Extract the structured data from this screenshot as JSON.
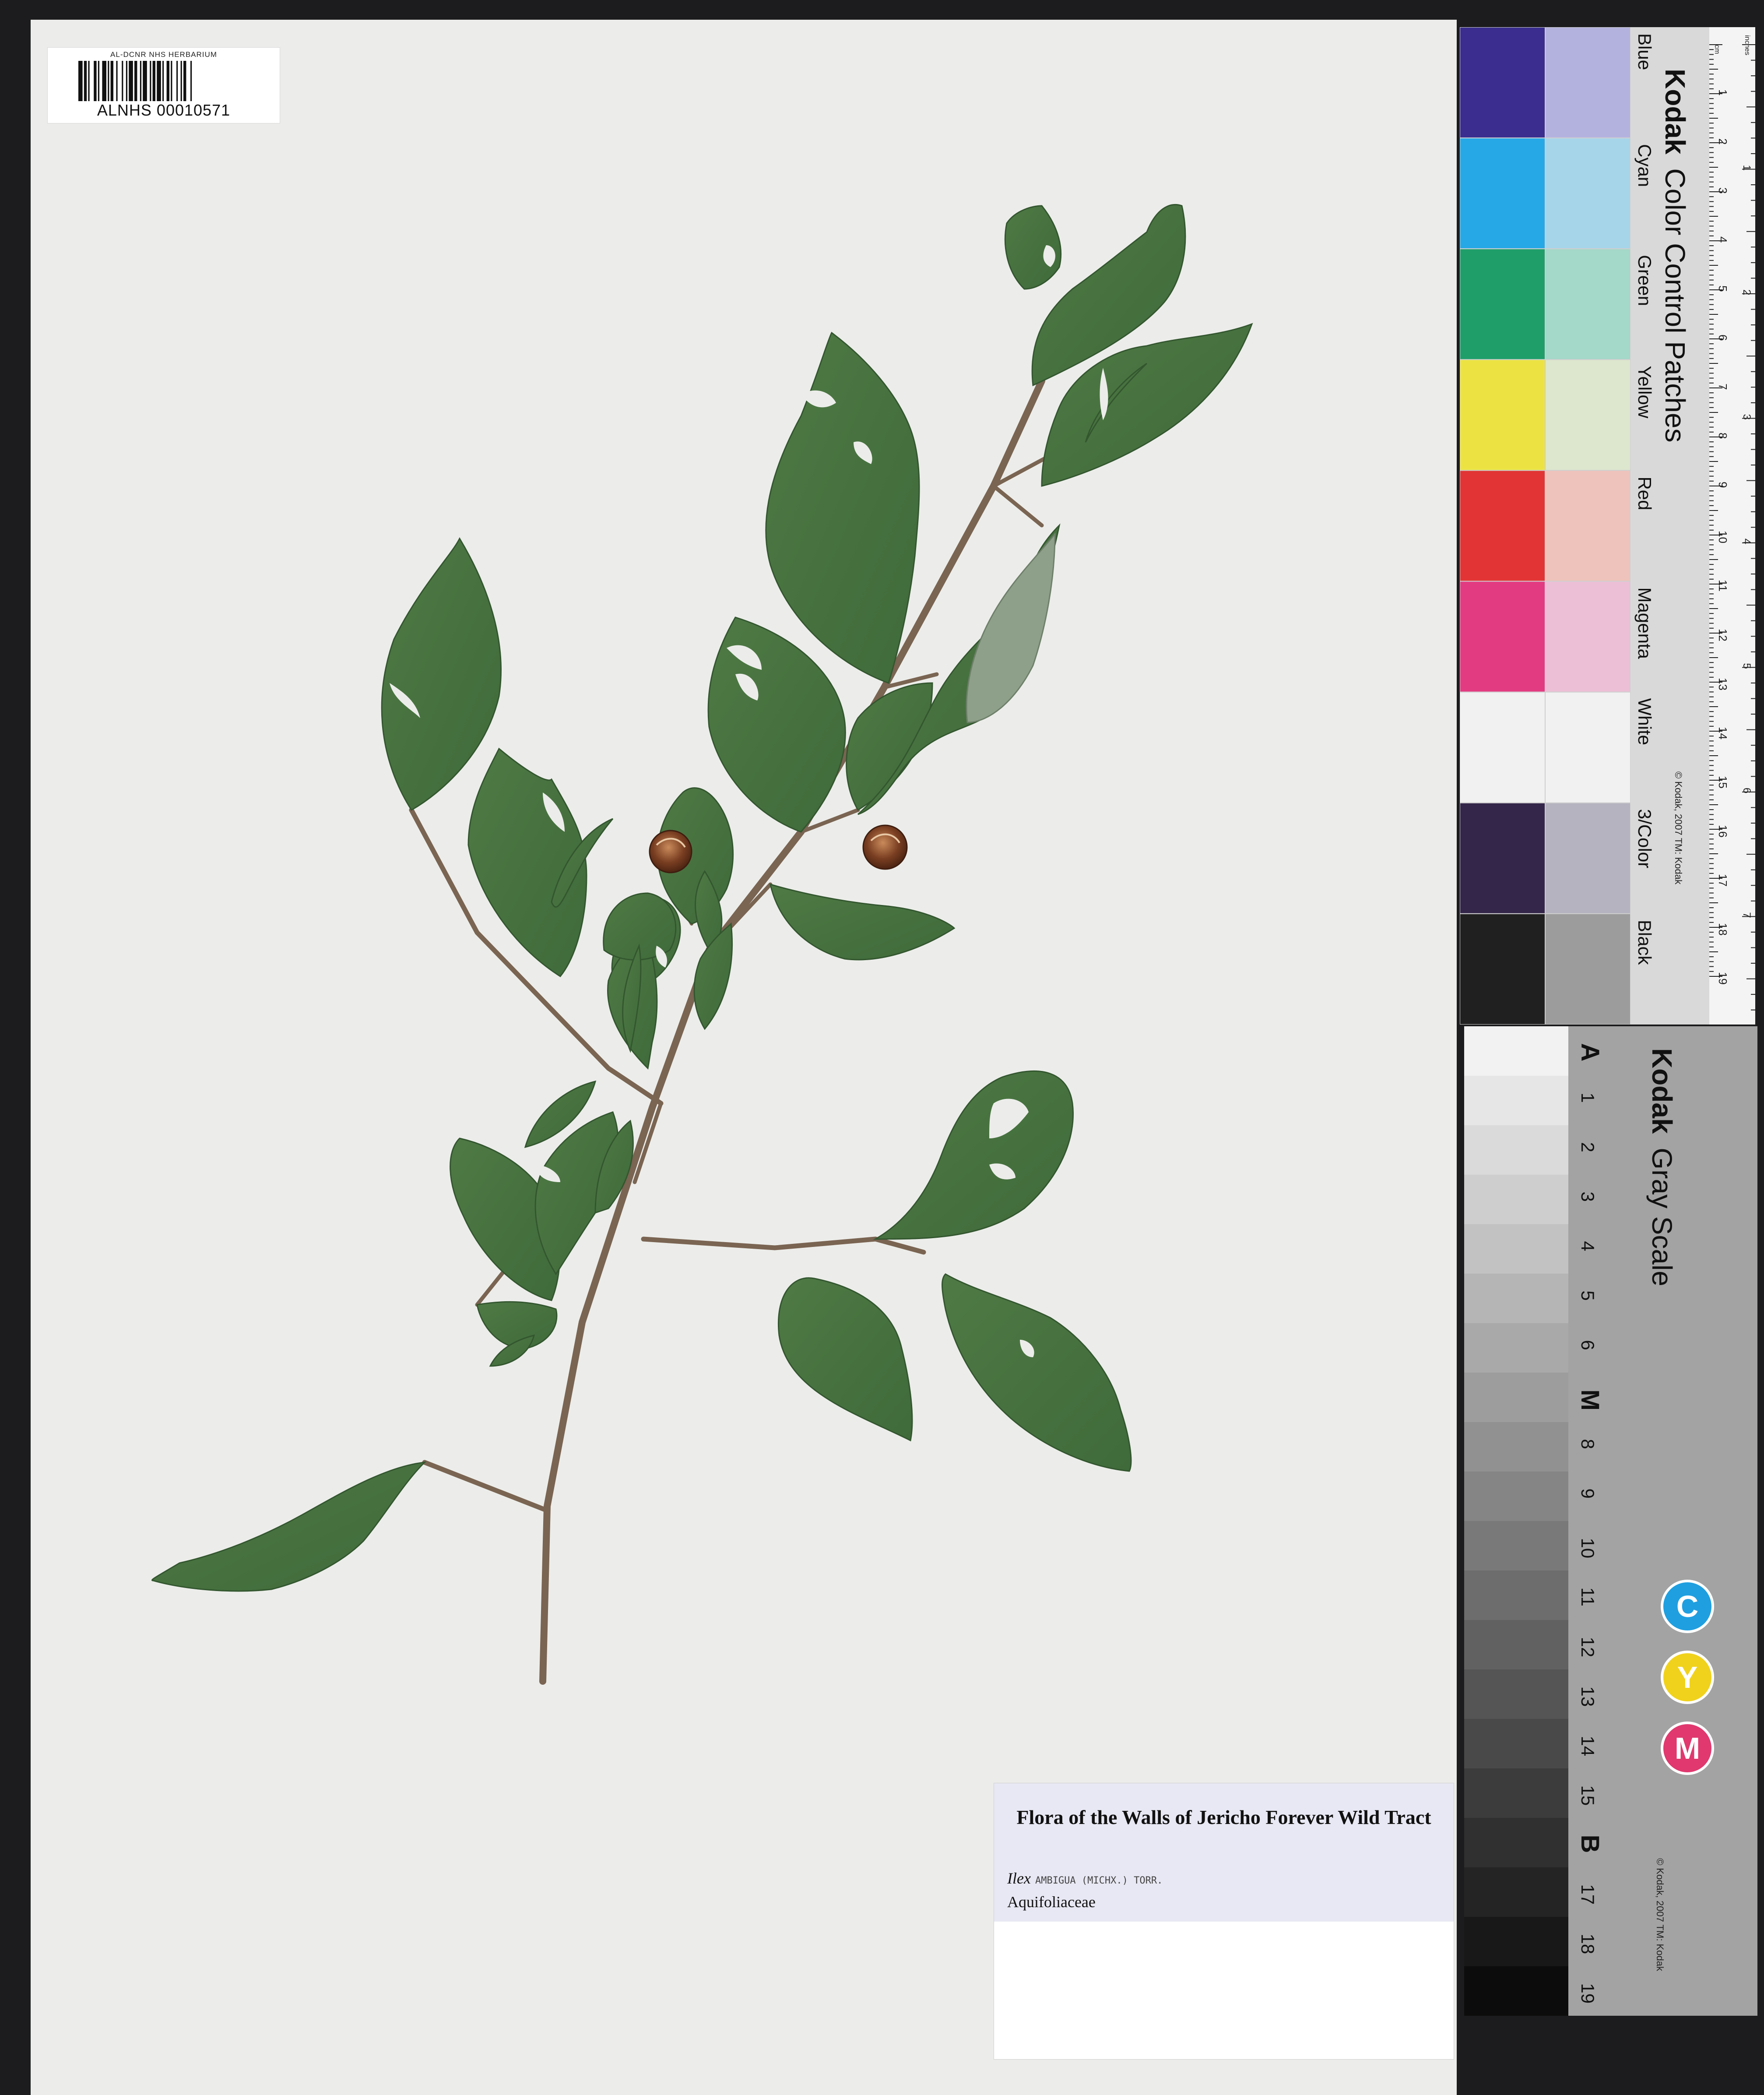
{
  "barcode_label": {
    "institution": "AL-DCNR NHS HERBARIUM",
    "catalog_number": "ALNHS 00010571"
  },
  "color_card": {
    "title_brand": "Kodak",
    "title_rest": "Color Control Patches",
    "copyright": "© Kodak, 2007 TM: Kodak",
    "ruler_unit_cm": "cm",
    "ruler_unit_in": "inches",
    "cm_ticks": [
      "1",
      "2",
      "3",
      "4",
      "5",
      "6",
      "7",
      "8",
      "9",
      "10",
      "11",
      "12",
      "13",
      "14",
      "15",
      "16",
      "17",
      "18",
      "19"
    ],
    "inch_ticks": [
      "1",
      "2",
      "3",
      "4",
      "5",
      "6",
      "7",
      "8"
    ],
    "patches": [
      {
        "name": "Blue",
        "dark": "#3a2d8f",
        "light": "#b3b2df"
      },
      {
        "name": "Cyan",
        "dark": "#27a8e6",
        "light": "#a6d5ea"
      },
      {
        "name": "Green",
        "dark": "#1f9e6a",
        "light": "#a4d8c9"
      },
      {
        "name": "Yellow",
        "dark": "#ece343",
        "light": "#dde7cd"
      },
      {
        "name": "Red",
        "dark": "#e23434",
        "light": "#eec3bb"
      },
      {
        "name": "Magenta",
        "dark": "#e33b82",
        "light": "#ecbfd6"
      },
      {
        "name": "White",
        "dark": "#f1f1f1",
        "light": "#f1f1f1"
      },
      {
        "name": "3/Color",
        "dark": "#34264a",
        "light": "#b4b3bf"
      },
      {
        "name": "Black",
        "dark": "#202020",
        "light": "#9c9c9c"
      }
    ]
  },
  "gray_card": {
    "title_brand": "Kodak",
    "title_rest": "Gray Scale",
    "copyright": "© Kodak, 2007 TM: Kodak",
    "steps": [
      "A",
      "1",
      "2",
      "3",
      "4",
      "5",
      "6",
      "M",
      "8",
      "9",
      "10",
      "11",
      "12",
      "13",
      "14",
      "15",
      "B",
      "17",
      "18",
      "19"
    ],
    "cym": [
      {
        "letter": "C",
        "color": "#1f9fe0"
      },
      {
        "letter": "Y",
        "color": "#f0d21c"
      },
      {
        "letter": "M",
        "color": "#e0386f"
      }
    ]
  },
  "specimen_label": {
    "title": "Flora of the Walls of Jericho Forever Wild Tract",
    "genus": "Ilex",
    "epithet_handwritten": "AMBIGUA (MICHX.) TORR.",
    "family": "Aquifoliaceae"
  }
}
